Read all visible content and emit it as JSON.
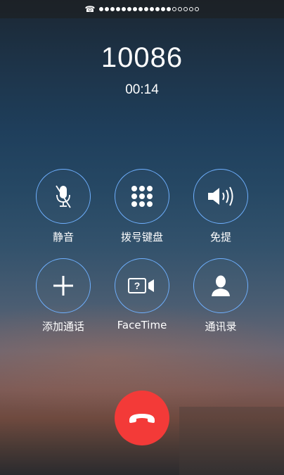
{
  "status_bar": {
    "phone_icon": "phone-handset-icon",
    "signal_dots_filled": 13,
    "signal_dots_total": 18
  },
  "call": {
    "number": "10086",
    "duration": "00:14"
  },
  "controls": [
    {
      "id": "mute",
      "label": "静音",
      "icon": "microphone-muted-icon"
    },
    {
      "id": "keypad",
      "label": "拨号键盘",
      "icon": "keypad-icon"
    },
    {
      "id": "speaker",
      "label": "免提",
      "icon": "speaker-icon"
    },
    {
      "id": "add-call",
      "label": "添加通话",
      "icon": "plus-icon"
    },
    {
      "id": "facetime",
      "label": "FaceTime",
      "icon": "facetime-icon"
    },
    {
      "id": "contacts",
      "label": "通讯录",
      "icon": "contact-person-icon"
    }
  ],
  "end_call": {
    "icon": "hang-up-icon"
  },
  "colors": {
    "button_ring": "#6fb0ff",
    "end_call": "#f33a38",
    "text": "#ffffff"
  }
}
